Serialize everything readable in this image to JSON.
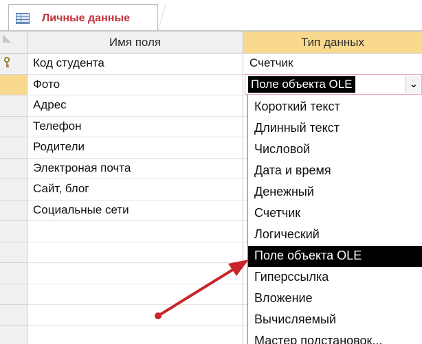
{
  "tab": {
    "title": "Личные данные",
    "icon": "table-icon"
  },
  "headers": {
    "field_name": "Имя поля",
    "data_type": "Тип данных"
  },
  "rows": [
    {
      "name": "Код студента",
      "type": "Счетчик",
      "primary_key": true
    },
    {
      "name": "Фото",
      "type": "Поле объекта OLE",
      "current": true
    },
    {
      "name": "Адрес",
      "type": ""
    },
    {
      "name": "Телефон",
      "type": ""
    },
    {
      "name": "Родители",
      "type": ""
    },
    {
      "name": "Электроная почта",
      "type": ""
    },
    {
      "name": "Сайт, блог",
      "type": ""
    },
    {
      "name": "Социальные сети",
      "type": ""
    },
    {
      "name": "",
      "type": ""
    },
    {
      "name": "",
      "type": ""
    },
    {
      "name": "",
      "type": ""
    },
    {
      "name": "",
      "type": ""
    },
    {
      "name": "",
      "type": ""
    },
    {
      "name": "",
      "type": ""
    }
  ],
  "combo": {
    "value": "Поле объекта OLE",
    "button_icon": "chevron-down-icon"
  },
  "dropdown": {
    "selected_index": 7,
    "options": [
      "Короткий текст",
      "Длинный текст",
      "Числовой",
      "Дата и время",
      "Денежный",
      "Счетчик",
      "Логический",
      "Поле объекта OLE",
      "Гиперссылка",
      "Вложение",
      "Вычисляемый",
      "Мастер подстановок..."
    ]
  },
  "colors": {
    "header_highlight": "#f9d98e",
    "tab_title": "#c3313e",
    "selection": "#000000",
    "annotation_arrow": "#c8262a"
  }
}
